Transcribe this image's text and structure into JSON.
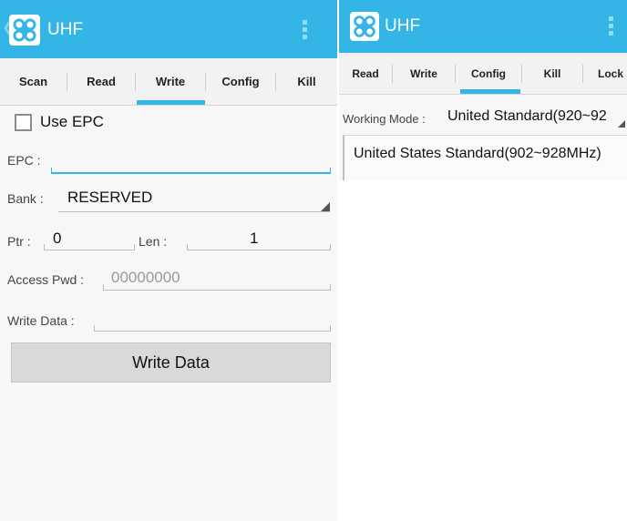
{
  "left": {
    "app": {
      "title": "UHF",
      "logo_icon": "app-logo-icon",
      "back_icon": "back-chevron-icon",
      "menu_icon": "overflow-menu-icon"
    },
    "tabs": [
      {
        "label": "Scan",
        "selected": false
      },
      {
        "label": "Read",
        "selected": false
      },
      {
        "label": "Write",
        "selected": true
      },
      {
        "label": "Config",
        "selected": false
      },
      {
        "label": "Kill",
        "selected": false
      }
    ],
    "use_epc": {
      "label": "Use EPC",
      "checked": false
    },
    "epc": {
      "label": "EPC :",
      "value": ""
    },
    "bank": {
      "label": "Bank :",
      "value": "RESERVED"
    },
    "ptr": {
      "label": "Ptr :",
      "value": "0"
    },
    "len": {
      "label": "Len :",
      "value": "1"
    },
    "access_pwd": {
      "label": "Access Pwd :",
      "placeholder": "00000000",
      "value": ""
    },
    "write_data": {
      "label": "Write Data :",
      "value": ""
    },
    "write_button": {
      "label": "Write Data"
    }
  },
  "right": {
    "app": {
      "title": "UHF",
      "logo_icon": "app-logo-icon",
      "menu_icon": "overflow-menu-icon"
    },
    "tabs": [
      {
        "label": "Read",
        "selected": false
      },
      {
        "label": "Write",
        "selected": false
      },
      {
        "label": "Config",
        "selected": true
      },
      {
        "label": "Kill",
        "selected": false
      },
      {
        "label": "Lock",
        "selected": false
      }
    ],
    "working_mode": {
      "label": "Working Mode :",
      "value": "United Standard(920~92"
    },
    "dropdown_options": [
      "United States Standard(902~928MHz)"
    ]
  },
  "colors": {
    "accent": "#33b5e5",
    "action_bar_text": "#ffffff",
    "button_bg": "#d9d9d9"
  }
}
